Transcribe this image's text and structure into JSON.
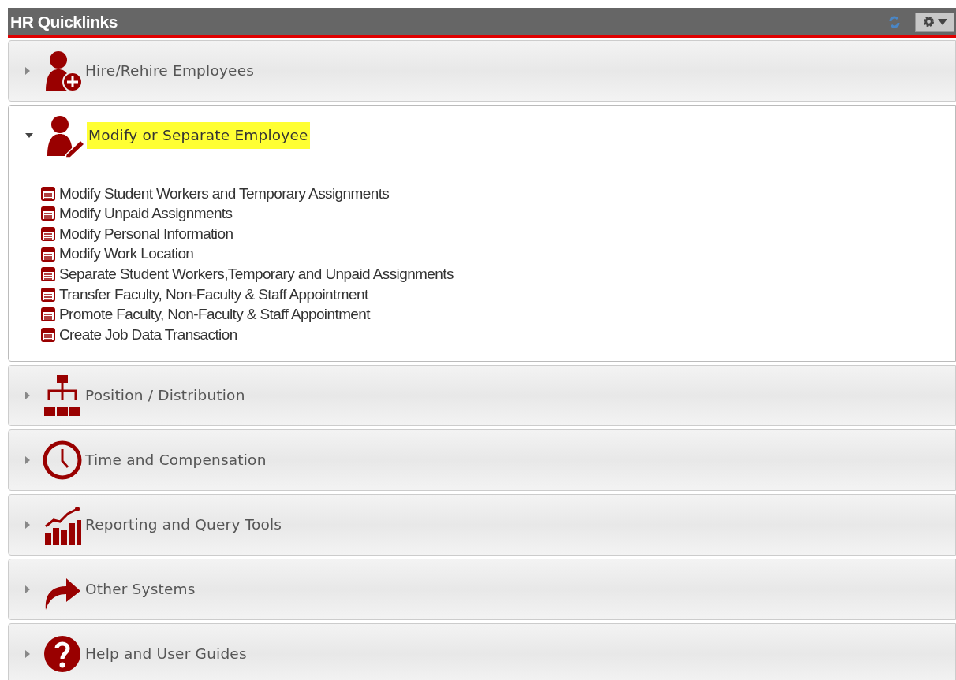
{
  "panel": {
    "title": "HR Quicklinks"
  },
  "sections": [
    {
      "label": "Hire/Rehire Employees",
      "expanded": false,
      "highlighted": false
    },
    {
      "label": "Modify or Separate Employee",
      "expanded": true,
      "highlighted": true,
      "links": [
        "Modify Student Workers and Temporary Assignments",
        "Modify Unpaid Assignments",
        "Modify Personal Information",
        "Modify Work Location",
        "Separate Student Workers,Temporary and Unpaid Assignments",
        "Transfer Faculty, Non-Faculty & Staff Appointment",
        "Promote Faculty, Non-Faculty & Staff Appointment",
        "Create Job Data Transaction"
      ]
    },
    {
      "label": "Position / Distribution",
      "expanded": false,
      "highlighted": false
    },
    {
      "label": "Time and Compensation",
      "expanded": false,
      "highlighted": false
    },
    {
      "label": "Reporting and Query Tools",
      "expanded": false,
      "highlighted": false
    },
    {
      "label": "Other Systems",
      "expanded": false,
      "highlighted": false
    },
    {
      "label": "Help and User Guides",
      "expanded": false,
      "highlighted": false
    }
  ]
}
